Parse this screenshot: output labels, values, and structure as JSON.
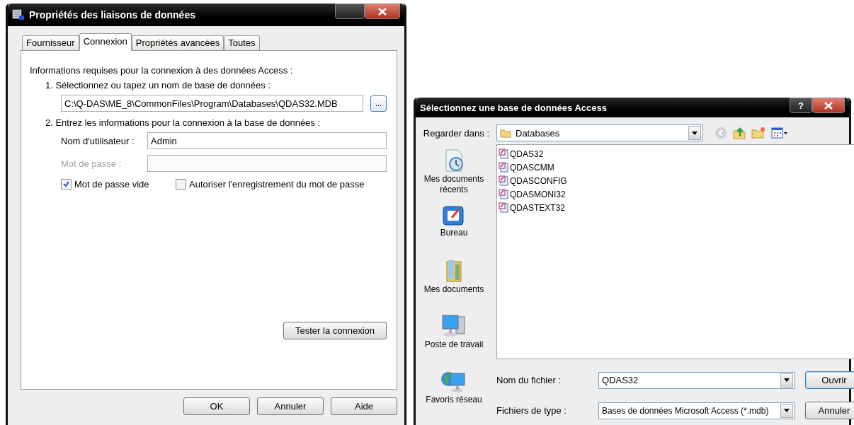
{
  "properties_window": {
    "title": "Propriétés des liaisons de données",
    "tabs": [
      {
        "label": "Fournisseur",
        "selected": false
      },
      {
        "label": "Connexion",
        "selected": true
      },
      {
        "label": "Propriétés avancées",
        "selected": false
      },
      {
        "label": "Toutes",
        "selected": false
      }
    ],
    "intro": "Informations requises pour la connexion à des données Access :",
    "step1": "1. Sélectionnez ou tapez un nom de base de données :",
    "path": "C:\\Q-DAS\\ME_8\\CommonFiles\\Program\\Databases\\QDAS32.MDB",
    "browse_button": "...",
    "step2": "2. Entrez les informations pour la connexion à la base de données :",
    "fields": [
      {
        "label": "Nom d'utilisateur :",
        "value": "Admin",
        "disabled": false
      },
      {
        "label": "Mot de passe :",
        "disabled": true
      }
    ],
    "checkboxes": [
      {
        "label": "Mot de passe vide",
        "checked": true
      },
      {
        "label": "Autoriser l'enregistrement du mot de passe",
        "checked": false
      }
    ],
    "test_button": "Tester la connexion",
    "buttons": [
      "OK",
      "Annuler",
      "Aide"
    ]
  },
  "file_dialog": {
    "title": "Sélectionnez une base de données Access",
    "help_button": "?",
    "look_in_label": "Regarder dans :",
    "look_in_value": "Databases",
    "places": [
      {
        "kind": "recent",
        "label": "Mes documents récents"
      },
      {
        "kind": "desktop",
        "label": "Bureau"
      },
      {
        "kind": "documents",
        "label": "Mes documents"
      },
      {
        "kind": "computer",
        "label": "Poste de travail"
      },
      {
        "kind": "network",
        "label": "Favoris réseau"
      }
    ],
    "files": [
      "QDAS32",
      "QDASCMM",
      "QDASCONFIG",
      "QDASMONI32",
      "QDASTEXT32"
    ],
    "filename_label": "Nom du fichier :",
    "filename_value": "QDAS32",
    "type_label": "Fichiers de type :",
    "type_value": "Bases de données Microsoft Access (*.mdb)",
    "buttons": [
      {
        "label": "Ouvrir",
        "default": true
      },
      {
        "label": "Annuler",
        "default": false
      }
    ]
  }
}
